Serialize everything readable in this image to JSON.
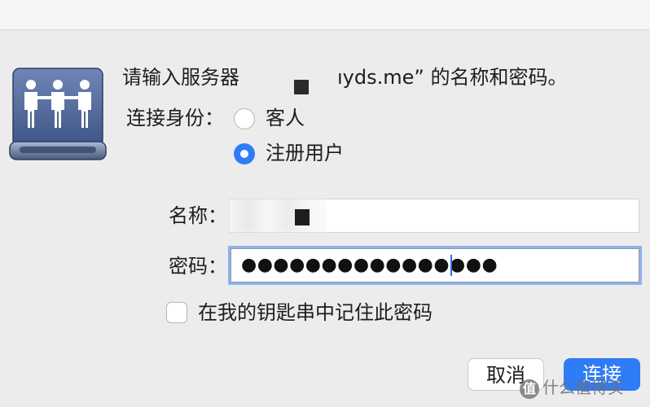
{
  "dialog": {
    "prompt_prefix": "请输入服务器",
    "prompt_suffix": "ıyds.me” 的名称和密码。",
    "connect_as_label": "连接身份：",
    "connect_options": [
      {
        "label": "客人",
        "selected": false
      },
      {
        "label": "注册用户",
        "selected": true
      }
    ],
    "name_label": "名称：",
    "name_value": "",
    "password_label": "密码：",
    "password_value": "●●●●●●●●●●●●●●●●",
    "remember_label": "在我的钥匙串中记住此密码",
    "remember_checked": false,
    "cancel_label": "取消",
    "connect_label": "连接"
  },
  "watermark": {
    "badge": "值",
    "text": "什么值得买"
  },
  "colors": {
    "accent": "#2f7cf6",
    "window_bg": "#ececec",
    "focus_ring": "#8ab3f0"
  },
  "icons": {
    "server": "shared-server-drive-icon"
  }
}
